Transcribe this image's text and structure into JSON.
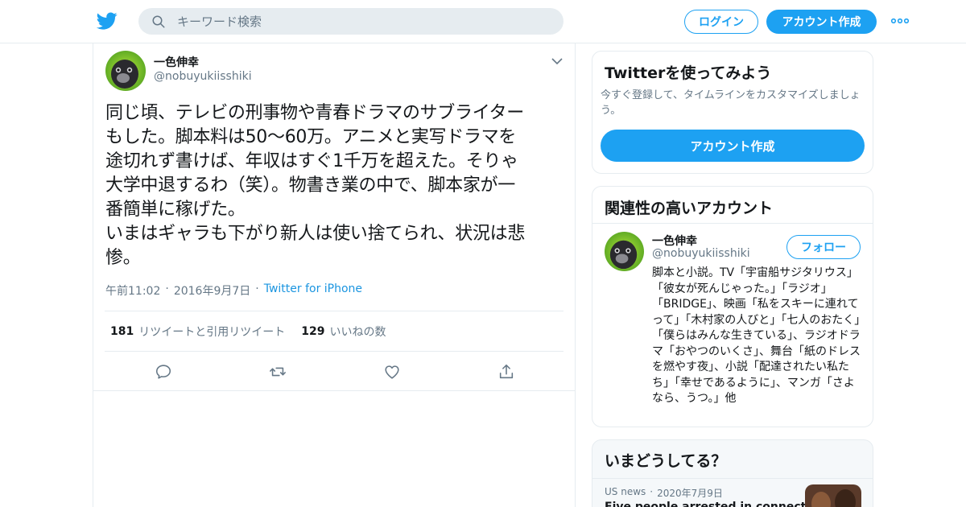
{
  "header": {
    "search_placeholder": "キーワード検索",
    "login_label": "ログイン",
    "signup_label": "アカウント作成",
    "icons": {
      "logo": "twitter-bird-icon",
      "search": "search-icon",
      "more": "more-dots-icon"
    },
    "accent_color": "#1da1f2"
  },
  "tweet": {
    "author_name": "一色伸幸",
    "author_handle": "@nobuyukiisshiki",
    "text": "同じ頃、テレビの刑事物や青春ドラマのサブライター\nもした。脚本料は50〜60万。アニメと実写ドラマを\n途切れず書けば、年収はすぐ1千万を超えた。そりゃ\n大学中退するわ（笑）。物書き業の中で、脚本家が一\n番簡単に稼げた。\nいまはギャラも下がり新人は使い捨てられ、状況は悲\n惨。",
    "time": "午前11:02",
    "date": "2016年9月7日",
    "source": "Twitter for iPhone",
    "retweets_count": "181",
    "retweets_label": "リツイートと引用リツイート",
    "likes_count": "129",
    "likes_label": "いいねの数",
    "actions": [
      "reply-icon",
      "retweet-icon",
      "like-icon",
      "share-icon"
    ]
  },
  "sidebar": {
    "signup_card": {
      "title": "Twitterを使ってみよう",
      "description": "今すぐ登録して、タイムラインをカスタマイズしましょう。",
      "button_label": "アカウント作成"
    },
    "related_card": {
      "title": "関連性の高いアカウント",
      "name": "一色伸幸",
      "handle": "@nobuyukiisshiki",
      "follow_label": "フォロー",
      "bio": "脚本と小説。TV「宇宙船サジタリウス」「彼女が死んじゃった。」「ラジオ」「BRIDGE」、映画「私をスキーに連れてって」「木村家の人びと」「七人のおたく」「僕らはみんな生きている」、ラジオドラマ「おやつのいくさ」、舞台「紙のドレスを燃やす夜」、小説「配達されたい私たち」「幸せであるように」、マンガ「さよなら、うつ。」他"
    },
    "trends_card": {
      "title": "いまどうしてる？",
      "source": "US news",
      "date": "2020年7月9日",
      "headline": "Five people arrested in connection"
    }
  }
}
